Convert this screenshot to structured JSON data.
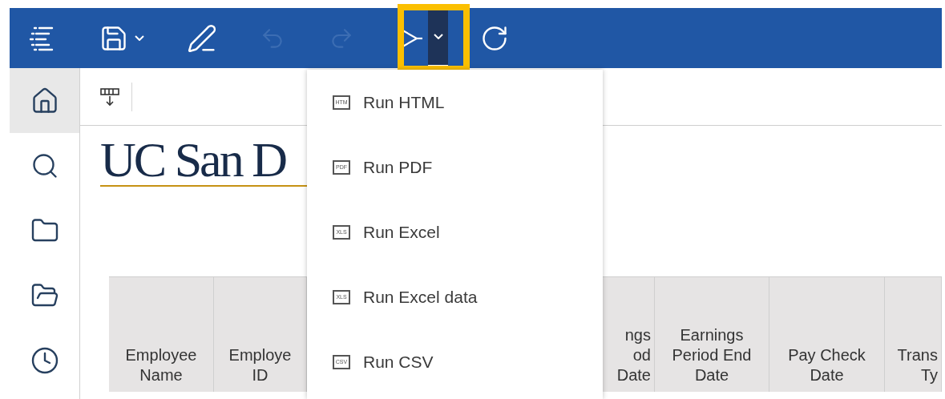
{
  "toolbar": {
    "items": [
      {
        "kind": "menu",
        "disabled": false
      },
      {
        "kind": "save",
        "disabled": false
      },
      {
        "kind": "caret",
        "disabled": false
      },
      {
        "kind": "edit",
        "disabled": false
      },
      {
        "kind": "undo",
        "disabled": true
      },
      {
        "kind": "redo",
        "disabled": true
      },
      {
        "kind": "run",
        "disabled": false
      },
      {
        "kind": "run-options",
        "disabled": false,
        "expanded": true
      },
      {
        "kind": "refresh",
        "disabled": false
      }
    ]
  },
  "sidebar": {
    "items": [
      {
        "kind": "home",
        "selected": true
      },
      {
        "kind": "search",
        "selected": false
      },
      {
        "kind": "folder",
        "selected": false
      },
      {
        "kind": "my-folder",
        "selected": false
      },
      {
        "kind": "recent",
        "selected": false
      }
    ]
  },
  "logo": {
    "text": "UC San D"
  },
  "run_menu": {
    "items": [
      {
        "label": "Run HTML",
        "badge": "HTM"
      },
      {
        "label": "Run PDF",
        "badge": "PDF"
      },
      {
        "label": "Run Excel",
        "badge": "XLS"
      },
      {
        "label": "Run Excel data",
        "badge": "XLS"
      },
      {
        "label": "Run CSV",
        "badge": "CSV"
      }
    ]
  },
  "table": {
    "columns": [
      {
        "label": "Employee\nName"
      },
      {
        "label": "Employe\nID"
      },
      {
        "label": "ngs\nod\nDate"
      },
      {
        "label": "Earnings\nPeriod End\nDate"
      },
      {
        "label": "Pay Check\nDate"
      },
      {
        "label": "Trans\nTy"
      }
    ]
  }
}
